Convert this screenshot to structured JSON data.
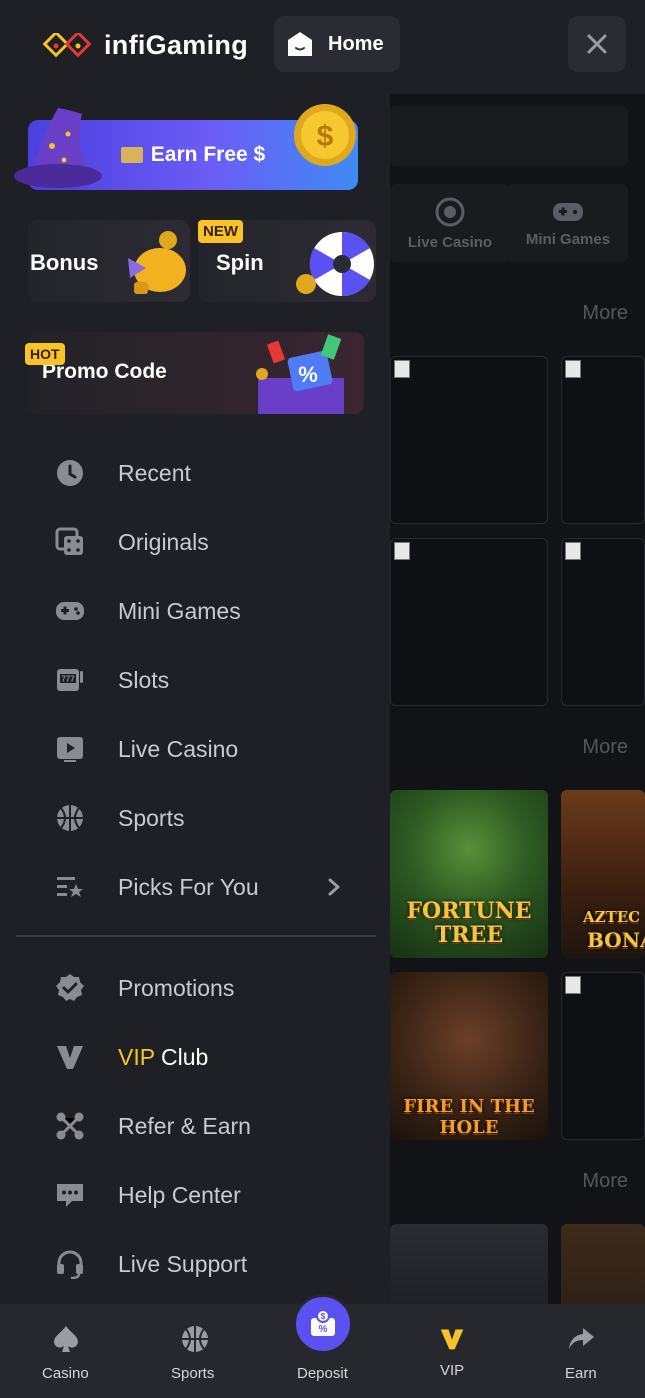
{
  "header": {
    "logo_text": "infiGaming",
    "home_label": "Home"
  },
  "background": {
    "categories": [
      "Live Casino",
      "Mini Games"
    ],
    "more_label": "More",
    "games": [
      {
        "title_line1": "FORTUNE",
        "title_line2": "TREE"
      },
      {
        "title_line1": "AZTEC",
        "title_line2": "BONA"
      },
      {
        "title_line1": "FIRE IN THE HOLE"
      }
    ]
  },
  "drawer": {
    "earn_banner_label": "Earn Free $",
    "bonus_label": "Bonus",
    "spin_label": "Spin",
    "spin_badge": "NEW",
    "promo_label": "Promo Code",
    "promo_badge": "HOT",
    "menu": [
      {
        "label": "Recent",
        "icon": "clock-icon"
      },
      {
        "label": "Originals",
        "icon": "dice-icon"
      },
      {
        "label": "Mini Games",
        "icon": "gamepad-icon"
      },
      {
        "label": "Slots",
        "icon": "slot-machine-icon"
      },
      {
        "label": "Live Casino",
        "icon": "play-icon"
      },
      {
        "label": "Sports",
        "icon": "basketball-icon"
      },
      {
        "label": "Picks For You",
        "icon": "list-star-icon"
      }
    ],
    "menu2": [
      {
        "label": "Promotions",
        "icon": "badge-check-icon"
      },
      {
        "label_accent": "VIP",
        "label_rest": " Club",
        "icon": "vip-icon"
      },
      {
        "label": "Refer & Earn",
        "icon": "share-nodes-icon"
      },
      {
        "label": "Help Center",
        "icon": "chat-icon"
      },
      {
        "label": "Live Support",
        "icon": "headset-icon"
      }
    ]
  },
  "bottom_nav": [
    {
      "label": "Casino",
      "icon": "spade-icon"
    },
    {
      "label": "Sports",
      "icon": "basketball-icon"
    },
    {
      "label": "Deposit",
      "icon": "deposit-icon"
    },
    {
      "label": "VIP",
      "icon": "vip-icon"
    },
    {
      "label": "Earn",
      "icon": "share-arrow-icon"
    }
  ],
  "colors": {
    "accent": "#f7c325",
    "brand_purple": "#5b50f0",
    "panel": "#1f2025"
  }
}
